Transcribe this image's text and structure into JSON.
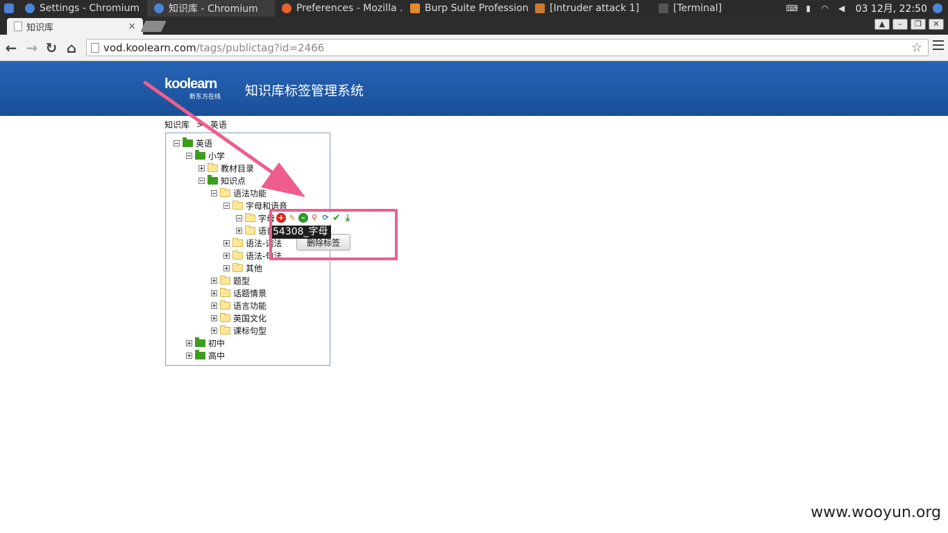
{
  "taskbar": {
    "tasks": [
      {
        "label": "Settings - Chromium",
        "icon": "chromium-icon",
        "color": "#4a86d8"
      },
      {
        "label": "知识库 - Chromium",
        "icon": "chromium-icon",
        "color": "#4a86d8"
      },
      {
        "label": "Preferences - Mozilla ...",
        "icon": "firefox-icon",
        "color": "#e8632a"
      },
      {
        "label": "Burp Suite Profession...",
        "icon": "burp-icon",
        "color": "#e58a2a"
      },
      {
        "label": "[Intruder attack 1]",
        "icon": "burp-icon",
        "color": "#c87a30"
      },
      {
        "label": "[Terminal]",
        "icon": "terminal-icon",
        "color": "#555555"
      }
    ],
    "clock": "03 12月, 22:50"
  },
  "browser": {
    "tab_title": "知识库",
    "url_host": "vod.koolearn.com",
    "url_path": "/tags/publictag?id=2466"
  },
  "header": {
    "brand_name": "koolearn",
    "brand_sub": "新东方在线",
    "system_title": "知识库标签管理系统"
  },
  "breadcrumb": {
    "root": "知识库",
    "separator": ">",
    "current": "英语"
  },
  "tree": [
    {
      "label": "英语",
      "state": "expanded",
      "folder": "green"
    },
    {
      "label": "小学",
      "state": "expanded",
      "folder": "green"
    },
    {
      "label": "教材目录",
      "state": "collapsed",
      "folder": "yellow"
    },
    {
      "label": "知识点",
      "state": "expanded",
      "folder": "green"
    },
    {
      "label": "语法功能",
      "state": "expanded",
      "folder": "yellow"
    },
    {
      "label": "字母和语音",
      "state": "expanded",
      "folder": "yellow"
    },
    {
      "label": "字母",
      "state": "expanded",
      "folder": "yellow"
    },
    {
      "label": "语音",
      "state": "collapsed",
      "folder": "yellow"
    },
    {
      "label": "语法-词法",
      "state": "collapsed",
      "folder": "yellow"
    },
    {
      "label": "语法-句法",
      "state": "collapsed",
      "folder": "yellow"
    },
    {
      "label": "其他",
      "state": "collapsed",
      "folder": "yellow"
    },
    {
      "label": "题型",
      "state": "collapsed",
      "folder": "yellow"
    },
    {
      "label": "话题情景",
      "state": "collapsed",
      "folder": "yellow"
    },
    {
      "label": "语言功能",
      "state": "collapsed",
      "folder": "yellow"
    },
    {
      "label": "英国文化",
      "state": "collapsed",
      "folder": "yellow"
    },
    {
      "label": "课标句型",
      "state": "collapsed",
      "folder": "yellow"
    },
    {
      "label": "初中",
      "state": "collapsed",
      "folder": "green"
    },
    {
      "label": "高中",
      "state": "collapsed",
      "folder": "green"
    }
  ],
  "node_toolbar": {
    "icons": [
      "add-icon",
      "edit-icon",
      "remove-icon",
      "search-icon",
      "refresh-icon",
      "check-icon",
      "download-icon"
    ]
  },
  "tooltip": "54308_字母",
  "delete_button": "删除标签",
  "watermark": "www.wooyun.org",
  "colors": {
    "banner": "#1f5aa8",
    "annotation": "#ef5d8c",
    "tree_border": "#7fa0c8"
  }
}
